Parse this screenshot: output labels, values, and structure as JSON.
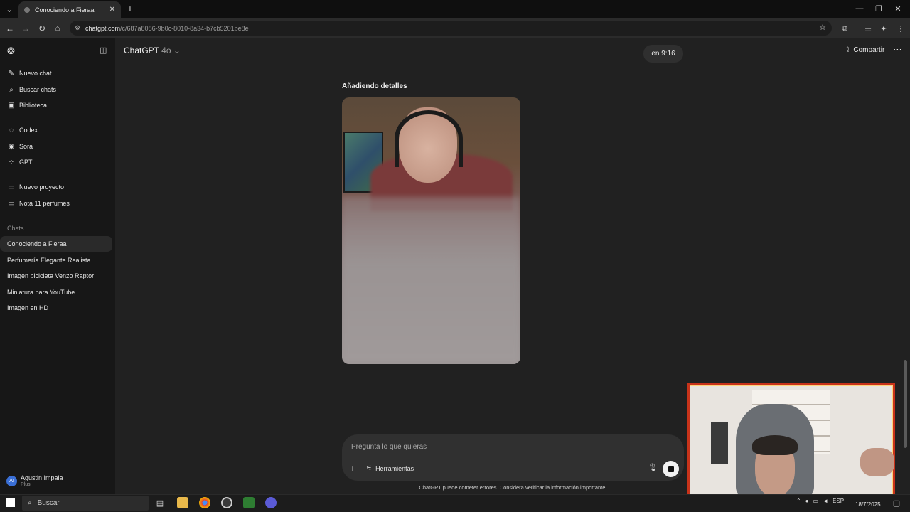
{
  "browser": {
    "tab_title": "Conociendo a Fieraa",
    "url_host": "chatgpt.com",
    "url_path": "/c/687a8086-9b0c-8010-8a34-b7cb5201be8e"
  },
  "sidebar": {
    "top_items": [
      {
        "label": "Nuevo chat",
        "icon": "edit-icon"
      },
      {
        "label": "Buscar chats",
        "icon": "search-icon"
      },
      {
        "label": "Biblioteca",
        "icon": "library-icon"
      }
    ],
    "tools": [
      {
        "label": "Codex",
        "icon": "codex-icon"
      },
      {
        "label": "Sora",
        "icon": "sora-icon"
      },
      {
        "label": "GPT",
        "icon": "grid-icon"
      }
    ],
    "projects": [
      {
        "label": "Nuevo proyecto",
        "icon": "folder-plus-icon"
      },
      {
        "label": "Nota 11 perfumes",
        "icon": "folder-icon"
      }
    ],
    "chats_heading": "Chats",
    "chats": [
      {
        "label": "Conociendo a Fieraa",
        "active": true
      },
      {
        "label": "Perfumería Elegante Realista"
      },
      {
        "label": "Imagen bicicleta Venzo Raptor"
      },
      {
        "label": "Miniatura para YouTube"
      },
      {
        "label": "Imagen en HD"
      }
    ],
    "user": {
      "initials": "AI",
      "name": "Agustin Impala",
      "plan": "Plus"
    }
  },
  "header": {
    "model_name": "ChatGPT",
    "model_version": "4o",
    "timer": "en 9:16",
    "share_label": "Compartir"
  },
  "conversation": {
    "status_text": "Añadiendo detalles"
  },
  "composer": {
    "placeholder": "Pregunta lo que quieras",
    "tools_label": "Herramientas",
    "disclaimer": "ChatGPT puede cometer errores. Considera verificar la información importante."
  },
  "taskbar": {
    "search_label": "Buscar",
    "language": "ESP",
    "date": "18/7/2025"
  },
  "colors": {
    "sidebar_bg": "#171717",
    "main_bg": "#212121",
    "webcam_border": "#c8331a"
  }
}
